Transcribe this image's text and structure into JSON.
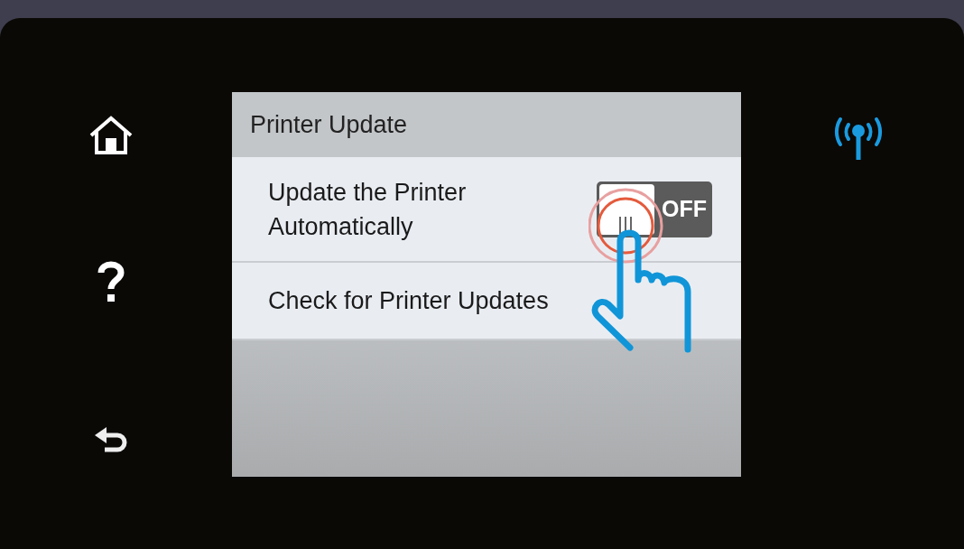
{
  "screen": {
    "title": "Printer Update",
    "items": [
      {
        "kind": "toggle",
        "label": "Update the Printer\nAutomatically",
        "switch": {
          "on": false,
          "state_label": "OFF"
        }
      },
      {
        "kind": "action",
        "label": "Check for Printer Updates"
      }
    ]
  }
}
